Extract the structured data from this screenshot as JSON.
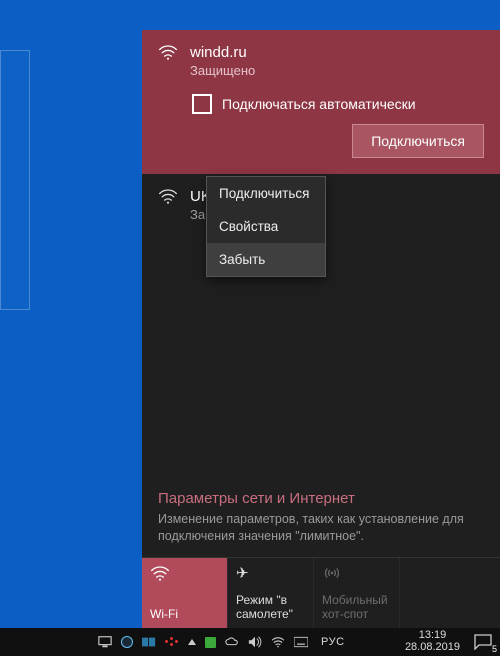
{
  "network_selected": {
    "ssid": "windd.ru",
    "status": "Защищено",
    "auto_connect_label": "Подключаться автоматически",
    "connect_button": "Подключиться"
  },
  "network_other": {
    "ssid_partial": "UKr",
    "status_partial": "Зац"
  },
  "context_menu": {
    "items": [
      "Подключиться",
      "Свойства",
      "Забыть"
    ],
    "hover_index": 2
  },
  "settings": {
    "title": "Параметры сети и Интернет",
    "desc": "Изменение параметров, таких как установление для подключения значения \"лимитное\"."
  },
  "tiles": {
    "wifi": "Wi-Fi",
    "airplane": "Режим \"в самолете\"",
    "hotspot": "Мобильный хот-спот"
  },
  "taskbar": {
    "lang": "РУС",
    "time": "13:19",
    "date": "28.08.2019",
    "notif_count": "5"
  }
}
